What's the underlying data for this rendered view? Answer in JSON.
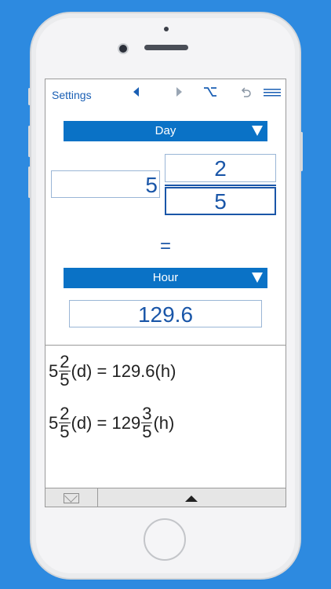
{
  "toolbar": {
    "settings_label": "Settings",
    "icons": [
      "back-arrow-icon",
      "forward-arrow-icon",
      "option-key-icon",
      "undo-icon",
      "menu-icon"
    ],
    "accent": "#1a5fb4"
  },
  "from_unit": {
    "label": "Day",
    "color": "#0a72c6"
  },
  "input": {
    "whole": "5",
    "numerator": "2",
    "denominator": "5"
  },
  "equals": "=",
  "to_unit": {
    "label": "Hour"
  },
  "result": "129.6",
  "history": [
    {
      "whole": "5",
      "num": "2",
      "den": "5",
      "from": "(d) = ",
      "result": "129.6",
      "to": "(h)"
    },
    {
      "whole": "5",
      "num": "2",
      "den": "5",
      "from": "(d) = ",
      "result_whole": "129",
      "result_num": "3",
      "result_den": "5",
      "to": "(h)"
    }
  ],
  "background": "#2d8ae0"
}
